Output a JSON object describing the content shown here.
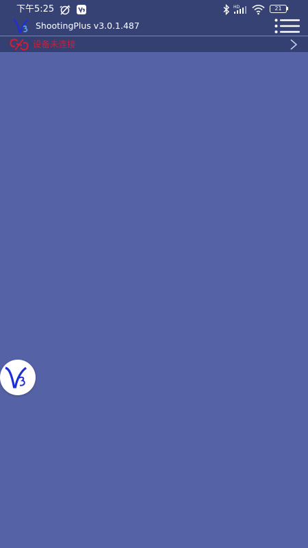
{
  "status_bar": {
    "time": "下午5:25",
    "battery": "21",
    "icons": [
      "alarm-off-icon",
      "notification-app-icon",
      "bluetooth-icon",
      "hd-signal-icon",
      "cellular-signal-icon",
      "wifi-icon",
      "battery-icon"
    ]
  },
  "app_bar": {
    "title": "ShootingPlus v3.0.1.487",
    "logo_icon": "v3-logo-icon",
    "menu_icon": "hamburger-menu-icon"
  },
  "device_bar": {
    "status": "设备未连接",
    "icon": "link-broken-icon",
    "chevron": "chevron-right-icon"
  },
  "floating_button": {
    "icon": "v3-logo-icon"
  },
  "colors": {
    "background": "#5563a6",
    "top_bar": "#364274",
    "device_bar": "#343f72",
    "status_red": "#d81b34",
    "logo_blue": "#1f2fd6"
  }
}
